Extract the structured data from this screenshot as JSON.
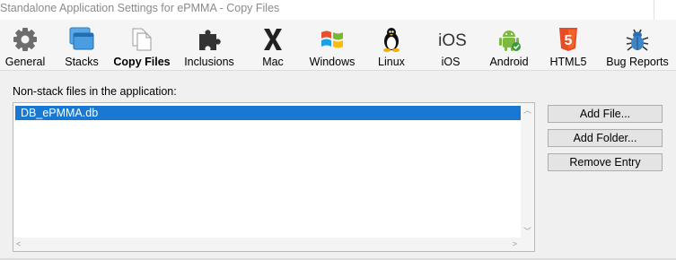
{
  "window": {
    "title": "Standalone Application Settings for ePMMA - Copy Files"
  },
  "toolbar": {
    "items": [
      {
        "label": "General",
        "icon": "gear-icon",
        "active": false
      },
      {
        "label": "Stacks",
        "icon": "stacks-icon",
        "active": false
      },
      {
        "label": "Copy Files",
        "icon": "copy-files-icon",
        "active": true
      },
      {
        "label": "Inclusions",
        "icon": "puzzle-icon",
        "active": false
      },
      {
        "label": "Mac",
        "icon": "mac-x-icon",
        "active": false
      },
      {
        "label": "Windows",
        "icon": "windows-logo-icon",
        "active": false
      },
      {
        "label": "Linux",
        "icon": "tux-penguin-icon",
        "active": false
      },
      {
        "label": "iOS",
        "icon": "ios-text-icon",
        "icon_text": "iOS",
        "active": false
      },
      {
        "label": "Android",
        "icon": "android-icon",
        "active": false
      },
      {
        "label": "HTML5",
        "icon": "html5-shield-icon",
        "icon_text": "5",
        "active": false
      },
      {
        "label": "Bug Reports",
        "icon": "bug-icon",
        "active": false
      }
    ]
  },
  "main": {
    "section_label": "Non-stack files in the application:",
    "files": [
      {
        "name": "DB_ePMMA.db",
        "selected": true
      }
    ],
    "buttons": {
      "add_file": "Add File...",
      "add_folder": "Add Folder...",
      "remove_entry": "Remove Entry"
    }
  },
  "colors": {
    "selection": "#1979d2",
    "window_bg": "#f0f0f0",
    "toolbar_bg": "#f5f5f5"
  }
}
